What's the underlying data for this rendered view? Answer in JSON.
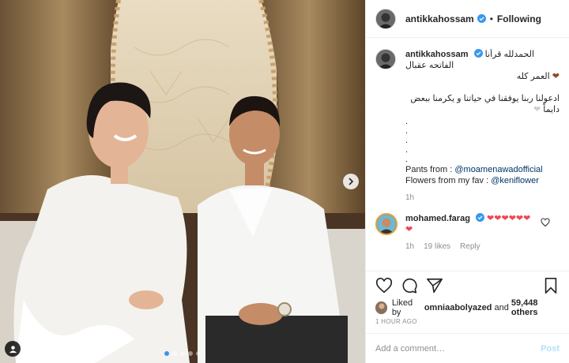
{
  "header": {
    "username": "antikkahossam",
    "separator": "•",
    "follow_label": "Following"
  },
  "caption": {
    "username": "antikkahossam",
    "line1": "الحمدلله قرأنا الفاتحه عقبال",
    "line2": "العمر كله",
    "line3": "ادعولنا ربنا يوفقنا في حياتنا و يكرمنا ببعض دايماً",
    "dots": [
      ".",
      ".",
      ".",
      ".",
      "."
    ],
    "pants_label": "Pants from :",
    "pants_link": "@moamenawadofficial",
    "flowers_label": "Flowers from my fav :",
    "flowers_link": "@keniflower",
    "time": "1h"
  },
  "comment": {
    "username": "mohamed.farag",
    "hearts": "❤❤❤❤❤❤",
    "hearts2": "❤",
    "time": "1h",
    "likes": "19 likes",
    "reply": "Reply"
  },
  "likes": {
    "prefix": "Liked by",
    "user": "omniaabolyazed",
    "and": "and",
    "count": "59,448 others"
  },
  "timestamp": "1 HOUR AGO",
  "add_comment": {
    "placeholder": "Add a comment…",
    "post_label": "Post"
  },
  "carousel": {
    "total": 5,
    "active": 1
  },
  "colors": {
    "verified": "#3897f0",
    "link": "#003569",
    "heart": "#ed4956"
  },
  "icons": [
    "heart-icon",
    "comment-icon",
    "share-icon",
    "bookmark-icon",
    "chevron-right-icon",
    "user-tag-icon",
    "verified-badge-icon"
  ]
}
